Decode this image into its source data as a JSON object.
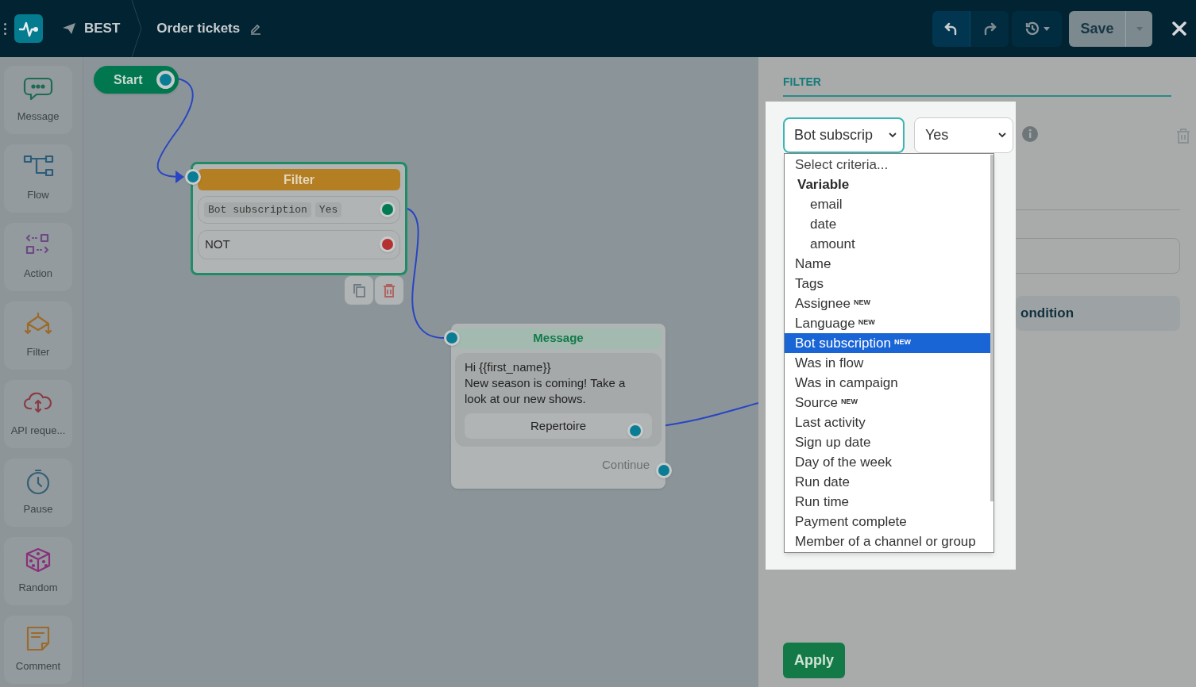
{
  "header": {
    "bot_name": "BEST",
    "flow_title": "Order tickets",
    "save_label": "Save"
  },
  "sidebar": {
    "items": [
      {
        "label": "Message",
        "kind": "message"
      },
      {
        "label": "Flow",
        "kind": "flow"
      },
      {
        "label": "Action",
        "kind": "action"
      },
      {
        "label": "Filter",
        "kind": "filter"
      },
      {
        "label": "API reque...",
        "kind": "api"
      },
      {
        "label": "Pause",
        "kind": "pause"
      },
      {
        "label": "Random",
        "kind": "random"
      },
      {
        "label": "Comment",
        "kind": "comment"
      }
    ]
  },
  "canvas": {
    "start": {
      "label": "Start"
    },
    "filter_node": {
      "title": "Filter",
      "conditions": [
        {
          "criterion": "Bot subscription",
          "value": "Yes"
        }
      ],
      "else_label": "NOT"
    },
    "message_node": {
      "title": "Message",
      "text": "Hi {{first_name}}\nNew season is coming! Take a look at our new shows.",
      "button": "Repertoire",
      "continue_label": "Continue"
    }
  },
  "panel": {
    "title": "FILTER",
    "criterion_select": {
      "value": "Bot subscrip"
    },
    "value_select": {
      "value": "Yes"
    },
    "add_condition_button": "ondition",
    "apply_button": "Apply",
    "dropdown": {
      "options": [
        {
          "label": "Select criteria...",
          "kind": "placeholder",
          "selected": false
        },
        {
          "label": "Variable",
          "kind": "group",
          "selected": false,
          "children": [
            {
              "label": "email",
              "kind": "option",
              "selected": false
            },
            {
              "label": "date",
              "kind": "option",
              "selected": false
            },
            {
              "label": "amount",
              "kind": "option",
              "selected": false
            }
          ]
        },
        {
          "label": "Name",
          "kind": "option",
          "selected": false
        },
        {
          "label": "Tags",
          "kind": "option",
          "selected": false
        },
        {
          "label": "Assignee",
          "badge": "NEW",
          "kind": "option",
          "selected": false
        },
        {
          "label": "Language",
          "badge": "NEW",
          "kind": "option",
          "selected": false
        },
        {
          "label": "Bot subscription",
          "badge": "NEW",
          "kind": "option",
          "selected": true
        },
        {
          "label": "Was in flow",
          "kind": "option",
          "selected": false
        },
        {
          "label": "Was in campaign",
          "kind": "option",
          "selected": false
        },
        {
          "label": "Source",
          "badge": "NEW",
          "kind": "option",
          "selected": false
        },
        {
          "label": "Last activity",
          "kind": "option",
          "selected": false
        },
        {
          "label": "Sign up date",
          "kind": "option",
          "selected": false
        },
        {
          "label": "Day of the week",
          "kind": "option",
          "selected": false
        },
        {
          "label": "Run date",
          "kind": "option",
          "selected": false
        },
        {
          "label": "Run time",
          "kind": "option",
          "selected": false
        },
        {
          "label": "Payment complete",
          "kind": "option",
          "selected": false
        },
        {
          "label": "Member of a channel or group",
          "kind": "option",
          "selected": false
        }
      ]
    }
  }
}
